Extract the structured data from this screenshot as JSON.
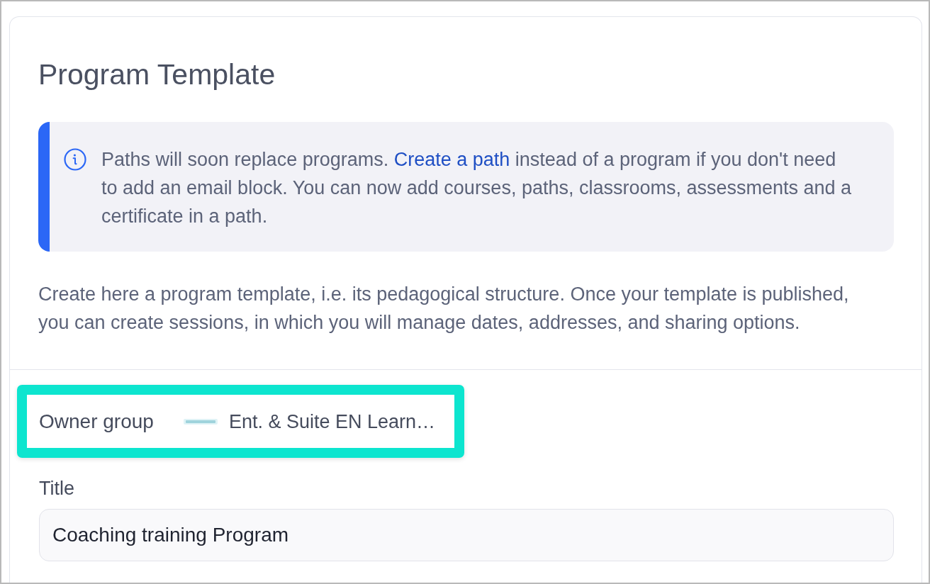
{
  "page": {
    "title": "Program Template"
  },
  "notice": {
    "text_before": "Paths will soon replace programs.",
    "link": "Create a path",
    "text_after": "instead of a program if you don't need to add an email block. You can now add courses, paths, classrooms, assessments and a certificate in a path."
  },
  "intro": "Create here a program template, i.e. its pedagogical structure. Once your template is published, you can create sessions, in which you will manage dates, addresses, and sharing options.",
  "owner_group": {
    "label": "Owner group",
    "value": "Ent. & Suite EN Learn…",
    "highlighted": true
  },
  "fields": [
    {
      "label": "Title",
      "value": "Coaching training Program"
    }
  ]
}
